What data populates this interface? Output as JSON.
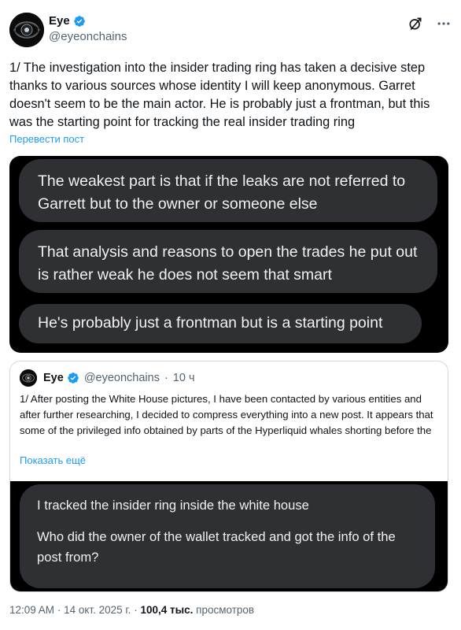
{
  "author": {
    "name": "Eye",
    "handle": "@eyeonchains"
  },
  "post": {
    "text": "1/ The investigation into the insider trading ring has taken a decisive step thanks to various sources whose identity I will keep anonymous. Garret doesn't seem to be the main actor. He is probably just a frontman, but this was the starting point for tracking the real insider trading ring",
    "translate_label": "Перевести пост"
  },
  "attached_image": {
    "messages": [
      "The weakest part is that if the leaks are not referred to Garrett but to the owner or someone else",
      "That analysis and reasons to open the trades he put out is rather weak he does not seem that smart",
      "He's probably just a frontman but is a starting point"
    ]
  },
  "quoted_post": {
    "name": "Eye",
    "handle": "@eyeonchains",
    "separator": "·",
    "time": "10 ч",
    "text": "1/ After posting the White House pictures, I have been contacted by various entities and after further researching, I decided to compress everything into a new post. It appears that some of the privileged info obtained by parts of the Hyperliquid whales shorting before the",
    "show_more_label": "Показать ещё",
    "image": {
      "line1": "I tracked the insider ring inside the white house",
      "line2": "Who did the owner of the wallet tracked and got the info of the post from?"
    }
  },
  "footer": {
    "time": "12:09 AM",
    "dot": "·",
    "date": "14 окт. 2025 г.",
    "views_count": "100,4 тыс.",
    "views_label": "просмотров"
  },
  "icons": {
    "avatar": "eye-logo-icon",
    "verified": "verified-badge-icon",
    "grok": "grok-icon",
    "more": "more-icon"
  },
  "colors": {
    "link": "#1d9bf0",
    "verified": "#1d9bf0",
    "secondary_text": "#536471",
    "bubble": "#2f3034"
  }
}
